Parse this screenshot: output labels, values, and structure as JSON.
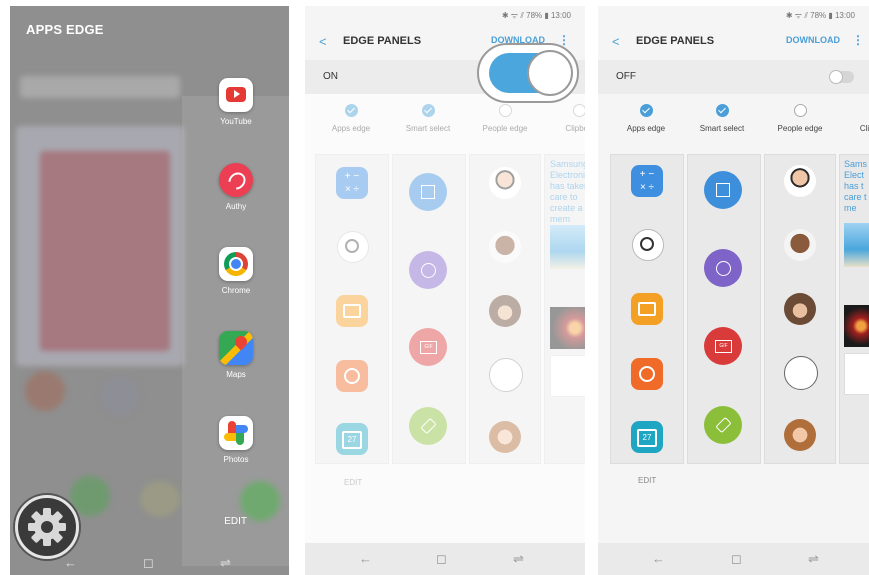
{
  "panel1": {
    "title": "APPS EDGE",
    "apps": [
      {
        "label": "YouTube",
        "icon": "youtube-icon"
      },
      {
        "label": "Authy",
        "icon": "authy-icon"
      },
      {
        "label": "Chrome",
        "icon": "chrome-icon"
      },
      {
        "label": "Maps",
        "icon": "maps-icon"
      },
      {
        "label": "Photos",
        "icon": "photos-icon"
      }
    ],
    "edit_label": "EDIT",
    "nav": {
      "back": "←",
      "home": "◻",
      "recent": "⇌"
    }
  },
  "panel2": {
    "status": "✱ ᯤ ⫽ 78% ▮ 13:00",
    "title": "EDGE PANELS",
    "download": "DOWNLOAD",
    "more": "⋮",
    "state": "ON",
    "options": [
      {
        "label": "Apps edge",
        "checked": true
      },
      {
        "label": "Smart select",
        "checked": true
      },
      {
        "label": "People edge",
        "checked": false
      },
      {
        "label": "Clipboa",
        "checked": false
      }
    ],
    "clip_text": "Samsung Electronics has taken care to create a mem",
    "edit_label": "EDIT",
    "nav": {
      "back": "←",
      "home": "◻",
      "recent": "⇌"
    }
  },
  "panel3": {
    "status": "✱ ᯤ ⫽ 78% ▮ 13:00",
    "title": "EDGE PANELS",
    "download": "DOWNLOAD",
    "more": "⋮",
    "state": "OFF",
    "options": [
      {
        "label": "Apps edge",
        "checked": true
      },
      {
        "label": "Smart select",
        "checked": true
      },
      {
        "label": "People edge",
        "checked": false
      },
      {
        "label": "Clipb",
        "checked": false
      }
    ],
    "clip_text": "Sams Elect has t care t a me",
    "calendar_day": "27",
    "edit_label": "EDIT",
    "nav": {
      "back": "←",
      "home": "◻",
      "recent": "⇌"
    }
  },
  "colors": {
    "accent": "#4a9fd8",
    "toggle_on": "#4aa6dc",
    "youtube": "#e53935",
    "authy": "#ec3f54",
    "smart_blue": "#3d8fdc",
    "smart_purple": "#7e63c8",
    "smart_red": "#d93a3a",
    "smart_green": "#8bbf3a",
    "calc": "#3f8fe0",
    "files": "#f4a024",
    "flower": "#f06a28",
    "calendar": "#1fa6c2"
  }
}
